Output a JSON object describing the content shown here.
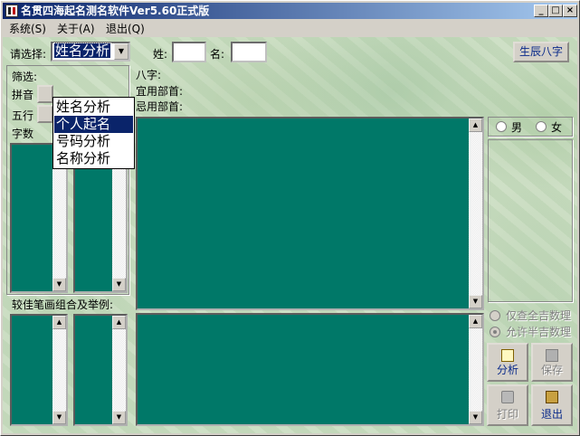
{
  "window": {
    "title": "名贯四海起名测名软件Ver5.60正式版",
    "controls": [
      "_",
      "□",
      "×"
    ]
  },
  "menu": {
    "items": [
      "系统(S)",
      "关于(A)",
      "退出(Q)"
    ]
  },
  "header": {
    "select_label": "请选择:",
    "select_value": "姓名分析",
    "surname_label": "姓:",
    "surname_value": "",
    "givenname_label": "名:",
    "givenname_value": "",
    "bazi_button": "生辰八字"
  },
  "dropdown": {
    "options": [
      "姓名分析",
      "个人起名",
      "号码分析",
      "名称分析"
    ],
    "selected_index": 1
  },
  "filter": {
    "title": "筛选:",
    "pinyin_label": "拼音",
    "wuxing_label": "五行",
    "zishu_label": "字数"
  },
  "info": {
    "bazi_label": "八字:",
    "yiyong_label": "宜用部首:",
    "jiyong_label": "忌用部首:"
  },
  "lower_left": {
    "label": "较佳笔画组合及举例:"
  },
  "gender": {
    "male": "男",
    "female": "女"
  },
  "shuli": {
    "option1": "仅查全吉数理",
    "option2": "允许半吉数理"
  },
  "actions": {
    "analyze": "分析",
    "save": "保存",
    "print": "打印",
    "exit": "退出"
  },
  "colors": {
    "panel": "#007868",
    "title_start": "#0a246a",
    "title_end": "#a6caf0",
    "selection": "#0a246a"
  }
}
